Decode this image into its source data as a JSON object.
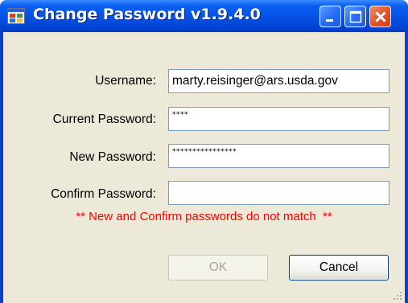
{
  "window": {
    "title": "Change Password v1.9.4.0",
    "title_color": "#ffffff",
    "titlebar_color": "#0553e6",
    "client_color": "#ece9d8"
  },
  "titlebar_buttons": {
    "minimize_icon": "minimize-icon",
    "maximize_icon": "maximize-icon",
    "close_icon": "close-icon"
  },
  "form": {
    "username_label": "Username:",
    "username_value": "marty.reisinger@ars.usda.gov",
    "current_password_label": "Current Password:",
    "current_password_value": "****",
    "new_password_label": "New Password:",
    "new_password_value": "****************",
    "confirm_password_label": "Confirm Password:",
    "confirm_password_value": ""
  },
  "error": {
    "message": "** New and Confirm passwords do not match  **",
    "color": "#ff0000"
  },
  "buttons": {
    "ok_label": "OK",
    "ok_enabled": false,
    "cancel_label": "Cancel"
  }
}
